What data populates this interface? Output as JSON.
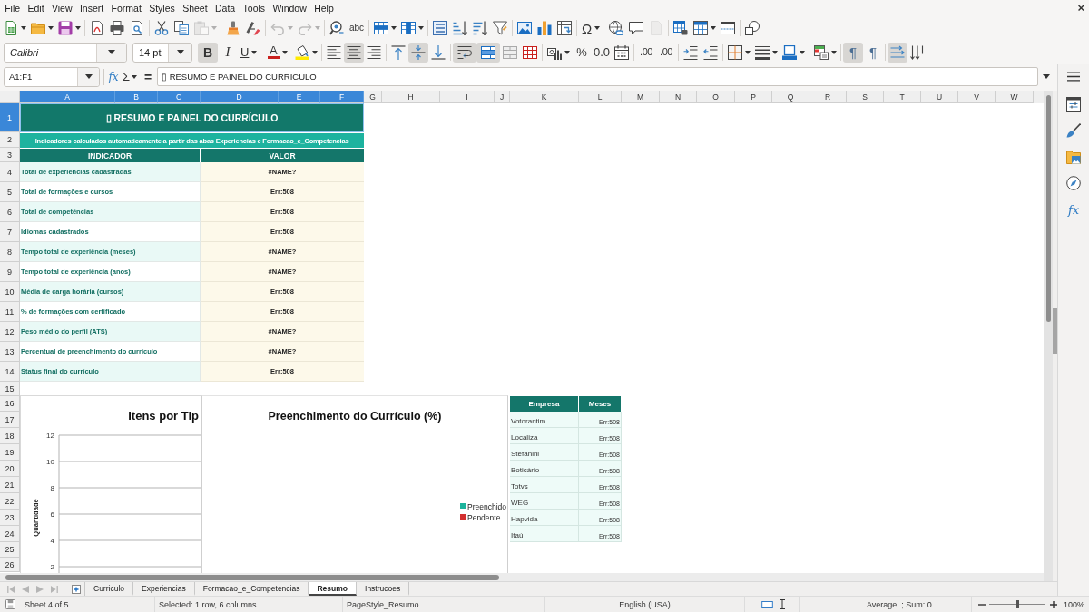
{
  "menu_bar": {
    "items": [
      "File",
      "Edit",
      "View",
      "Insert",
      "Format",
      "Styles",
      "Sheet",
      "Data",
      "Tools",
      "Window",
      "Help"
    ],
    "close": "×"
  },
  "standard_toolbar": [
    {
      "disabled": false
    },
    {
      "disabled": false
    },
    {
      "disabled": false
    },
    {
      "disabled": false
    },
    {
      "disabled": false
    },
    {
      "disabled": false
    },
    {
      "disabled": false
    },
    {
      "disabled": false
    },
    {
      "disabled": true
    },
    {
      "disabled": false
    },
    {
      "disabled": false
    },
    {
      "disabled": true
    },
    {
      "disabled": true
    },
    {
      "disabled": false
    },
    {
      "glyph": "abc",
      "disabled": false
    },
    {
      "disabled": false
    },
    {
      "disabled": false
    },
    {
      "disabled": false
    },
    {
      "disabled": false
    },
    {
      "disabled": false
    },
    {
      "disabled": false
    },
    {
      "disabled": false
    },
    {
      "disabled": false
    },
    {
      "disabled": false
    },
    {
      "glyph": "Ω",
      "disabled": false
    },
    {
      "disabled": false
    },
    {
      "disabled": false
    },
    {
      "disabled": true
    },
    {
      "disabled": false
    },
    {
      "disabled": false
    },
    {
      "disabled": false
    },
    {
      "disabled": false
    }
  ],
  "formatting_toolbar": {
    "font_name": "Calibri",
    "font_size": "14 pt",
    "buttons": [
      {
        "glyph": "B",
        "on": true
      },
      {
        "glyph": "I",
        "on": false
      },
      {
        "glyph": "U",
        "on": false
      },
      {
        "glyph": "A",
        "on": false
      },
      {
        "on": false
      },
      {
        "on": false
      },
      {
        "on": true
      },
      {
        "on": false
      },
      {
        "on": false
      },
      {
        "on": true
      },
      {
        "on": false
      },
      {
        "on": true
      },
      {
        "on": true
      },
      {
        "on": false
      },
      {
        "on": false
      },
      {
        "on": false
      },
      {
        "glyph": "%",
        "on": false
      },
      {
        "glyph": "0.0",
        "on": false
      },
      {
        "on": false
      },
      {
        "glyph": ".00",
        "on": false
      },
      {
        "glyph": ".00",
        "on": false
      },
      {
        "on": false
      },
      {
        "on": false
      },
      {
        "on": false
      },
      {
        "on": false
      },
      {
        "on": false
      },
      {
        "on": false
      },
      {
        "glyph": "¶",
        "on": true
      },
      {
        "glyph": "¶",
        "on": false
      },
      {
        "on": true
      },
      {
        "on": false
      }
    ]
  },
  "formula_bar": {
    "name_box": "A1:F1",
    "buttons": [
      "fx",
      "Σ",
      "="
    ],
    "content": "▯ RESUMO E PAINEL DO CURRÍCULO"
  },
  "sidebar": {
    "functions_button": "fx"
  },
  "column_headers": [
    {
      "label": "A",
      "selected": true
    },
    {
      "label": "B",
      "selected": true
    },
    {
      "label": "C",
      "selected": true
    },
    {
      "label": "D",
      "selected": true
    },
    {
      "label": "E",
      "selected": true
    },
    {
      "label": "F",
      "selected": true
    },
    {
      "label": "G",
      "selected": false
    },
    {
      "label": "H",
      "selected": false
    },
    {
      "label": "I",
      "selected": false
    },
    {
      "label": "J",
      "selected": false
    },
    {
      "label": "K",
      "selected": false
    },
    {
      "label": "L",
      "selected": false
    },
    {
      "label": "M",
      "selected": false
    },
    {
      "label": "N",
      "selected": false
    },
    {
      "label": "O",
      "selected": false
    },
    {
      "label": "P",
      "selected": false
    },
    {
      "label": "Q",
      "selected": false
    },
    {
      "label": "R",
      "selected": false
    },
    {
      "label": "S",
      "selected": false
    },
    {
      "label": "T",
      "selected": false
    },
    {
      "label": "U",
      "selected": false
    },
    {
      "label": "V",
      "selected": false
    },
    {
      "label": "W",
      "selected": false
    }
  ],
  "row_headers": [
    {
      "label": "1",
      "selected": true
    },
    {
      "label": "2",
      "selected": false
    },
    {
      "label": "3",
      "selected": false
    },
    {
      "label": "4",
      "selected": false
    },
    {
      "label": "5",
      "selected": false
    },
    {
      "label": "6",
      "selected": false
    },
    {
      "label": "7",
      "selected": false
    },
    {
      "label": "8",
      "selected": false
    },
    {
      "label": "9",
      "selected": false
    },
    {
      "label": "10",
      "selected": false
    },
    {
      "label": "11",
      "selected": false
    },
    {
      "label": "12",
      "selected": false
    },
    {
      "label": "13",
      "selected": false
    },
    {
      "label": "14",
      "selected": false
    },
    {
      "label": "15",
      "selected": false
    },
    {
      "label": "16",
      "selected": false
    },
    {
      "label": "17",
      "selected": false
    },
    {
      "label": "18",
      "selected": false
    },
    {
      "label": "19",
      "selected": false
    },
    {
      "label": "20",
      "selected": false
    },
    {
      "label": "21",
      "selected": false
    },
    {
      "label": "22",
      "selected": false
    },
    {
      "label": "23",
      "selected": false
    },
    {
      "label": "24",
      "selected": false
    },
    {
      "label": "25",
      "selected": false
    },
    {
      "label": "26",
      "selected": false
    }
  ],
  "summary": {
    "title": "▯ RESUMO E PAINEL DO CURRÍCULO",
    "subtitle": "Indicadores calculados automaticamente a partir das abas Experiencias e Formacao_e_Competencias",
    "columns": [
      "INDICADOR",
      "VALOR"
    ],
    "rows": [
      {
        "indicator": "Total de experiências cadastradas",
        "value": "#NAME?"
      },
      {
        "indicator": "Total de formações e cursos",
        "value": "Err:508"
      },
      {
        "indicator": "Total de competências",
        "value": "Err:508"
      },
      {
        "indicator": "Idiomas cadastrados",
        "value": "Err:508"
      },
      {
        "indicator": "Tempo total de experiência (meses)",
        "value": "#NAME?"
      },
      {
        "indicator": "Tempo total de experiência (anos)",
        "value": "#NAME?"
      },
      {
        "indicator": "Média de carga horária (cursos)",
        "value": "Err:508"
      },
      {
        "indicator": "% de formações com certificado",
        "value": "Err:508"
      },
      {
        "indicator": "Peso médio do perfil (ATS)",
        "value": "#NAME?"
      },
      {
        "indicator": "Percentual de preenchimento do currículo",
        "value": "#NAME?"
      },
      {
        "indicator": "Status final do currículo",
        "value": "Err:508"
      }
    ]
  },
  "charts": [
    {
      "kind": "bar",
      "title": "Itens por Tip",
      "axis_title": "Quantidade",
      "axis_ticks": [
        "12",
        "10",
        "8",
        "6",
        "4",
        "2"
      ]
    },
    {
      "kind": "pie",
      "title": "Preenchimento do Currículo (%)",
      "legend": [
        {
          "label": "Preenchido",
          "color": "#1bb39c"
        },
        {
          "label": "Pendente",
          "color": "#d32f2f"
        }
      ]
    }
  ],
  "experience_table": {
    "columns": [
      "Empresa",
      "Meses"
    ],
    "rows": [
      {
        "company": "Votorantim",
        "months": "Err:508"
      },
      {
        "company": "Localiza",
        "months": "Err:508"
      },
      {
        "company": "Stefanini",
        "months": "Err:508"
      },
      {
        "company": "Boticário",
        "months": "Err:508"
      },
      {
        "company": "Totvs",
        "months": "Err:508"
      },
      {
        "company": "WEG",
        "months": "Err:508"
      },
      {
        "company": "Hapvida",
        "months": "Err:508"
      },
      {
        "company": "Itaú",
        "months": "Err:508"
      }
    ]
  },
  "sheet_navigation": [
    {
      "disabled": true
    },
    {
      "disabled": true
    },
    {
      "disabled": true
    },
    {
      "disabled": true
    }
  ],
  "sheet_tabs": [
    {
      "label": "Curriculo",
      "selected": false
    },
    {
      "label": "Experiencias",
      "selected": false
    },
    {
      "label": "Formacao_e_Competencias",
      "selected": false
    },
    {
      "label": "Resumo",
      "selected": true
    },
    {
      "label": "Instrucoes",
      "selected": false
    }
  ],
  "status_bar": {
    "sheet": "Sheet 4 of 5",
    "selection": "Selected: 1 row, 6 columns",
    "page_style": "PageStyle_Resumo",
    "language": "English (USA)",
    "summary": "Average: ; Sum: 0",
    "zoom": {
      "level": 0.5,
      "reading": "100%"
    }
  }
}
